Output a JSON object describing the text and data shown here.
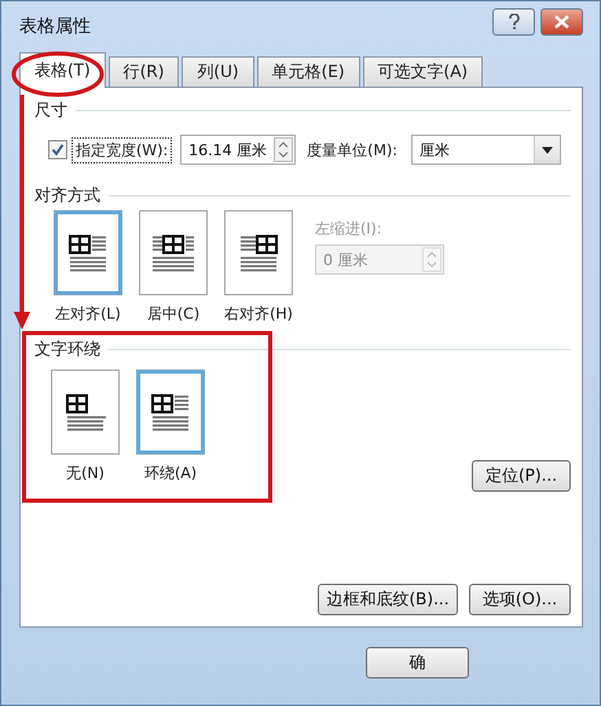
{
  "window": {
    "title": "表格属性"
  },
  "tabs": [
    {
      "label": "表格(T)",
      "selected": true
    },
    {
      "label": "行(R)",
      "selected": false
    },
    {
      "label": "列(U)",
      "selected": false
    },
    {
      "label": "单元格(E)",
      "selected": false
    },
    {
      "label": "可选文字(A)",
      "selected": false
    }
  ],
  "size": {
    "heading": "尺寸",
    "preferred_width": {
      "label": "指定宽度(W):",
      "checked": true,
      "value": "16.14 厘米"
    },
    "measure_in": {
      "label": "度量单位(M):",
      "value": "厘米"
    }
  },
  "alignment": {
    "heading": "对齐方式",
    "options": [
      {
        "label": "左对齐(L)",
        "kind": "left",
        "selected": true
      },
      {
        "label": "居中(C)",
        "kind": "center",
        "selected": false
      },
      {
        "label": "右对齐(H)",
        "kind": "right",
        "selected": false
      }
    ],
    "indent": {
      "label": "左缩进(I):",
      "value": "0 厘米",
      "disabled": true
    }
  },
  "text_wrapping": {
    "heading": "文字环绕",
    "options": [
      {
        "label": "无(N)",
        "kind": "none",
        "selected": false
      },
      {
        "label": "环绕(A)",
        "kind": "around",
        "selected": true
      }
    ]
  },
  "buttons": {
    "positioning": "定位(P)...",
    "borders": "边框和底纹(B)...",
    "options": "选项(O)...",
    "footer": [
      "确"
    ]
  }
}
